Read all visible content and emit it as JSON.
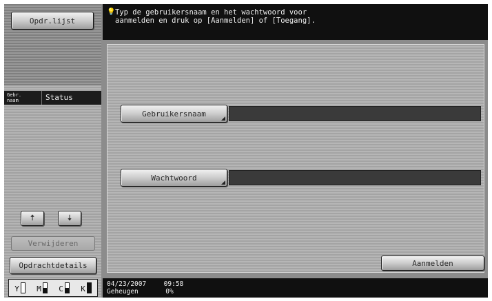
{
  "sidebar": {
    "job_list_label": "Opdr.lijst",
    "header": {
      "col_user": "Gebr.\nnaam",
      "col_status": "Status"
    },
    "up_icon": "arrow-up-icon",
    "down_icon": "arrow-down-icon",
    "up_glyph": "🠅",
    "down_glyph": "🠇",
    "delete_label": "Verwijderen",
    "details_label": "Opdrachtdetails",
    "toner": [
      {
        "letter": "Y",
        "level": 0.0
      },
      {
        "letter": "M",
        "level": 0.5
      },
      {
        "letter": "C",
        "level": 0.5
      },
      {
        "letter": "K",
        "level": 1.0
      }
    ]
  },
  "message": {
    "icon": "lightbulb-icon",
    "icon_glyph": "💡",
    "text": "Typ de gebruikersnaam en het wachtwoord voor\naanmelden en druk op [Aanmelden] of [Toegang]."
  },
  "form": {
    "username_label": "Gebruikersnaam",
    "username_value": "",
    "password_label": "Wachtwoord",
    "password_value": "",
    "login_label": "Aanmelden"
  },
  "status": {
    "date": "04/23/2007",
    "time": "09:58",
    "memory_label": "Geheugen",
    "memory_value": "0%"
  },
  "colors": {
    "black_bar": "#101010",
    "panel_gray": "#b6b6b6",
    "field_dark": "#3a3a3a"
  }
}
